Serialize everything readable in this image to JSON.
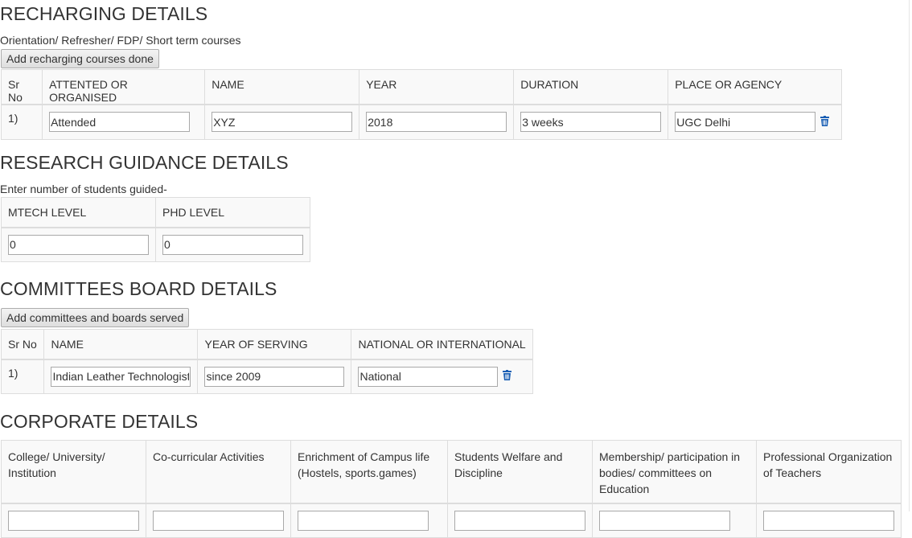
{
  "recharging": {
    "title": "RECHARGING DETAILS",
    "subtitle": "Orientation/ Refresher/ FDP/ Short term courses",
    "add_button": "Add recharging courses done",
    "headers": [
      "Sr No",
      "ATTENTED OR ORGANISED",
      "NAME",
      "YEAR",
      "DURATION",
      "PLACE OR AGENCY"
    ],
    "rows": [
      {
        "sr": "1)",
        "attended": "Attended",
        "name": "XYZ",
        "year": "2018",
        "duration": "3 weeks",
        "place": "UGC Delhi"
      }
    ]
  },
  "research": {
    "title": "RESEARCH GUIDANCE DETAILS",
    "subtitle": "Enter number of students guided-",
    "headers": [
      "MTECH LEVEL",
      "PHD LEVEL"
    ],
    "mtech": "0",
    "phd": "0"
  },
  "committees": {
    "title": "COMMITTEES BOARD DETAILS",
    "add_button": "Add committees and boards served",
    "headers": [
      "Sr No",
      "NAME",
      "YEAR OF SERVING",
      "NATIONAL OR INTERNATIONAL"
    ],
    "rows": [
      {
        "sr": "1)",
        "name": "Indian Leather Technologists",
        "year": "since 2009",
        "scope": "National"
      }
    ]
  },
  "corporate": {
    "title": "CORPORATE DETAILS",
    "headers": [
      "College/ University/ Institution",
      "Co-curricular Activities",
      "Enrichment of Campus life (Hostels, sports.games)",
      "Students Welfare and Discipline",
      "Membership/ participation in bodies/ committees on Education",
      "Professional Organization of Teachers"
    ]
  },
  "icons": {
    "delete": "trash-icon"
  },
  "colors": {
    "trash": "#1a5fb4",
    "button_border": "#adadad",
    "table_border": "#dddddd"
  }
}
